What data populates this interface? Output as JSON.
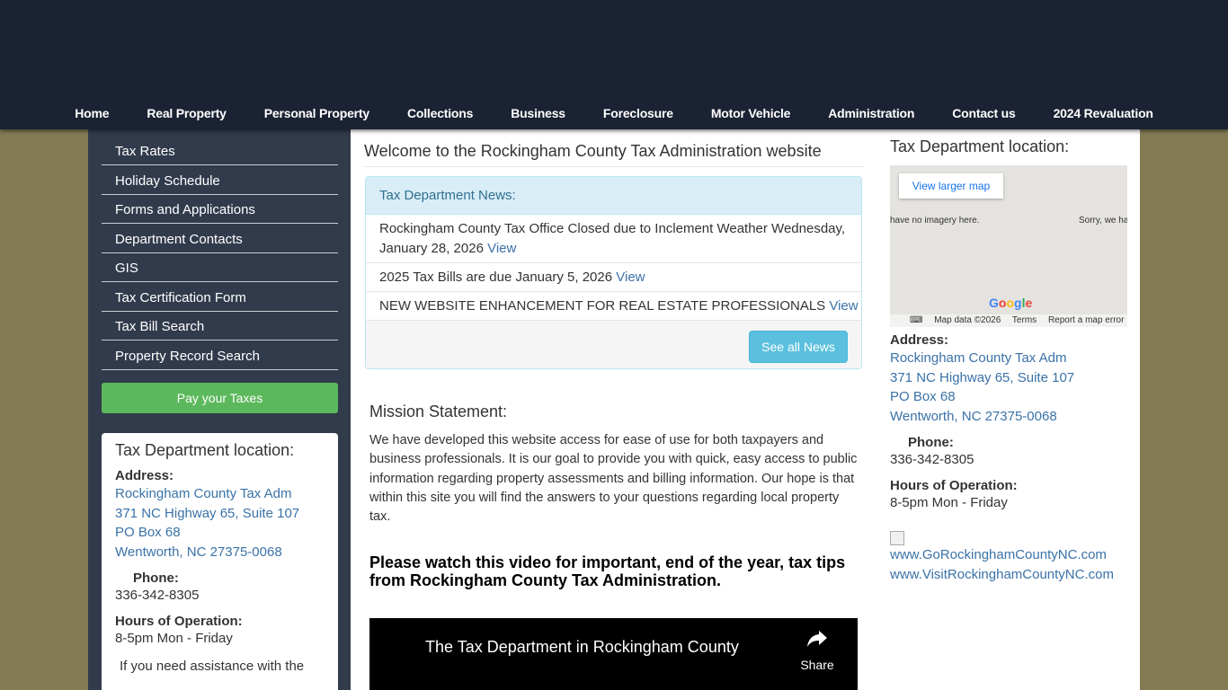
{
  "nav": {
    "items": [
      "Home",
      "Real Property",
      "Personal Property",
      "Collections",
      "Business",
      "Foreclosure",
      "Motor Vehicle",
      "Administration",
      "Contact us",
      "2024 Revaluation"
    ]
  },
  "sidebar": {
    "items": [
      "Tax Rates",
      "Holiday Schedule",
      "Forms and Applications",
      "Department Contacts",
      "GIS",
      "Tax Certification Form",
      "Tax Bill Search",
      "Property Record Search"
    ],
    "pay_button": "Pay your Taxes",
    "card": {
      "title": "Tax Department location:",
      "address_label": "Address:",
      "address": [
        "Rockingham County Tax Adm",
        "371 NC Highway 65, Suite 107",
        "PO Box 68",
        "Wentworth, NC 27375-0068"
      ],
      "phone_label": "Phone:",
      "phone": "336-342-8305",
      "hours_label": "Hours of Operation:",
      "hours": "8-5pm Mon - Friday",
      "assist_text": "If you need assistance with the"
    }
  },
  "main": {
    "welcome": "Welcome to the Rockingham County Tax Administration website",
    "news": {
      "heading": "Tax Department News:",
      "items": [
        {
          "text": "Rockingham County Tax Office Closed due to Inclement Weather Wednesday, January 28, 2026",
          "link": "View"
        },
        {
          "text": "2025 Tax Bills are due January 5, 2026",
          "link": "View"
        },
        {
          "text": "NEW WEBSITE ENHANCEMENT FOR REAL ESTATE PROFESSIONALS",
          "link": "View"
        }
      ],
      "see_all": "See all News"
    },
    "mission_title": "Mission Statement:",
    "mission_text": "We have developed this website access for ease of use for both taxpayers and business professionals. It is our goal to provide you with quick, easy access to public information regarding property assessments and billing information. Our hope is that within this site you will find the answers to your questions regarding local property tax.",
    "video_note": "Please watch this video for important, end of the year, tax tips from Rockingham County Tax Administration.",
    "video": {
      "title": "The Tax Department in Rockingham County",
      "share_label": "Share"
    }
  },
  "right": {
    "title": "Tax Department location:",
    "map": {
      "larger_map": "View larger map",
      "no_imagery_left": "have no imagery here.",
      "no_imagery_right": "Sorry, we ha",
      "google": "Google",
      "map_data": "Map data ©2026",
      "terms": "Terms",
      "report": "Report a map error"
    },
    "address_label": "Address:",
    "address": [
      "Rockingham County Tax Adm",
      "371 NC Highway 65, Suite 107",
      "PO Box 68",
      "Wentworth, NC 27375-0068"
    ],
    "phone_label": "Phone:",
    "phone": "336-342-8305",
    "hours_label": "Hours of Operation:",
    "hours": "8-5pm Mon - Friday",
    "links": [
      "www.GoRockinghamCountyNC.com",
      "www.VisitRockinghamCountyNC.com"
    ]
  },
  "colors": {
    "header_bg": "#1b2233",
    "page_bg": "#847b55",
    "sidebar_bg": "#323b4c",
    "pay_green": "#5cb85c",
    "info_blue": "#5bc0de",
    "link": "#3a72a8"
  }
}
